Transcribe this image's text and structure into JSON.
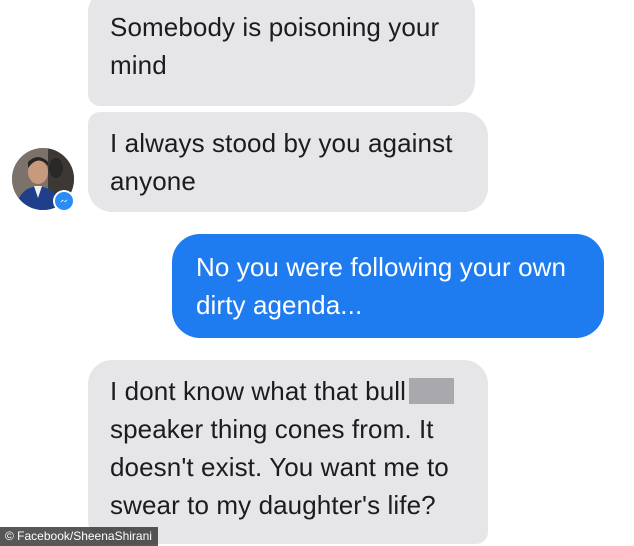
{
  "messages": [
    {
      "direction": "incoming",
      "lines": [
        "Somebody is poisoning your",
        "mind"
      ]
    },
    {
      "direction": "incoming",
      "lines": [
        "I always stood by you against",
        "anyone"
      ]
    },
    {
      "direction": "outgoing",
      "lines": [
        "No you were following your own",
        "dirty agenda..."
      ]
    },
    {
      "direction": "incoming",
      "lines": [
        "I dont know what that bull",
        "speaker thing cones from. It",
        "doesn't exist. You want me to",
        "swear to my daughter's life?"
      ]
    }
  ],
  "avatar": {
    "badge_icon": "messenger-icon"
  },
  "watermark": "© Facebook/SheenaShirani",
  "colors": {
    "incoming_bubble": "#e6e6e9",
    "outgoing_bubble": "#1e7cf0",
    "badge": "#2a8cf7"
  }
}
